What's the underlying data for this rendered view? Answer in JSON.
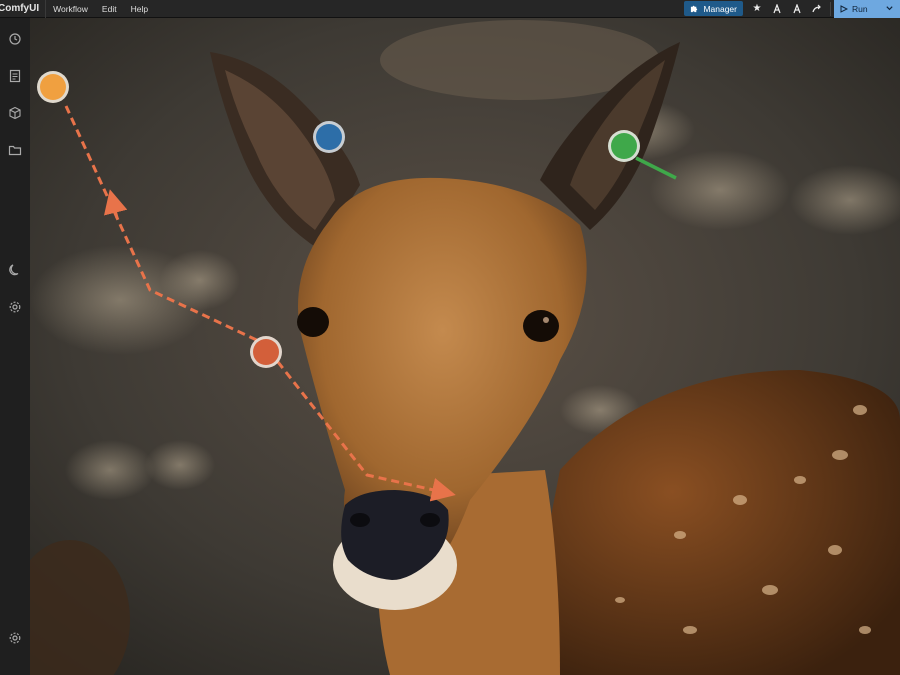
{
  "topbar": {
    "brand": "ComfyUI",
    "menu": [
      "Workflow",
      "Edit",
      "Help"
    ],
    "manager_label": "Manager",
    "run_label": "Run"
  },
  "sidebar": {
    "icons": [
      "history-icon",
      "document-icon",
      "cube-icon",
      "folder-icon",
      "moon-icon",
      "gear-icon",
      "settings-icon"
    ]
  },
  "canvas": {
    "description_colors": {
      "path": "#e8734a",
      "point_orange": "#f0a040",
      "point_blue": "#2d6ea8",
      "point_green": "#3fa84a",
      "point_red": "#d35f3a"
    }
  }
}
